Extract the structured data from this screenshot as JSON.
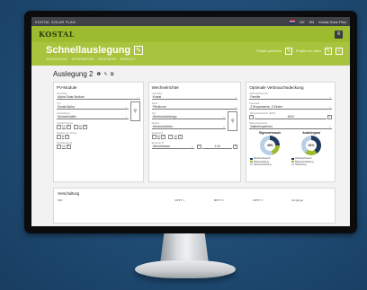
{
  "topbar": {
    "app_title": "KOSTAL SOLAR PLAN",
    "right_items": [
      "DE",
      "EN",
      "Kostal Solar Plan"
    ]
  },
  "brand": {
    "logo": "KOSTAL"
  },
  "page": {
    "title": "Schnellauslegung",
    "breadcrumb": [
      "AUSLEGUNG",
      "ERGEBNISSE",
      "GRAFIKEN",
      "BERICHT"
    ],
    "actions": [
      "Projekt speichern",
      "Projekt neu laden"
    ]
  },
  "variant": {
    "title": "Auslegung 2",
    "icons": "❶ ✎ ⧉"
  },
  "pv_panel": {
    "title": "PV-Module",
    "fields": [
      {
        "label": "Hersteller",
        "value": "Alpha Solar Module"
      },
      {
        "label": "Typ",
        "value": "Kostal Alpha"
      },
      {
        "label": "Ausrichtung",
        "value": "Monokristallin"
      }
    ],
    "num_rows": [
      {
        "label": "Anzahl Strings",
        "values": [
          "10",
          "10"
        ]
      },
      {
        "label": "Module pro String",
        "values": [
          "8"
        ]
      },
      {
        "label": "Modulleistung",
        "values": [
          "10"
        ]
      }
    ]
  },
  "inverter_panel": {
    "title": "Wechselrichter",
    "fields": [
      {
        "label": "Hersteller",
        "value": "Kostal"
      },
      {
        "label": "Serie",
        "value": "Plenticore"
      },
      {
        "label": "Typ",
        "value": "Wechselrichtertyp"
      },
      {
        "label": "Modell",
        "value": "Wechselrichter"
      }
    ],
    "num_rows": [
      {
        "label": "Eingang A",
        "values": [
          "10",
          "10"
        ]
      },
      {
        "label": "Eingang B",
        "values": [
          "Übernehmen",
          "1.00"
        ]
      }
    ]
  },
  "optimal_panel": {
    "title": "Optimale Verbrauchsdeckung",
    "fields": [
      {
        "label": "Verbrauchsprofil",
        "value": "Familie"
      },
      {
        "label": "Haushalt",
        "value": "2 Erwachsene, 2 Kinder"
      },
      {
        "label": "Jahresverbrauch (kWh)",
        "value": "4000"
      },
      {
        "label": "Batteriespeicher",
        "value": "Batteriespeicher"
      }
    ],
    "charts": [
      {
        "title": "Eigenverbrauch",
        "center": "45%",
        "legend": [
          "Direktverbrauch",
          "Batterieladung",
          "Netzeinspeisung"
        ]
      },
      {
        "title": "Autarkiegrad",
        "center": "61%",
        "legend": [
          "Direktverbrauch",
          "Batterieentladung",
          "Netzbezug"
        ]
      }
    ]
  },
  "bottom": {
    "title": "Verschaltung",
    "columns": [
      "MW",
      "MPPT 1",
      "MPPT 2",
      "MPPT 3",
      "Eingänge"
    ]
  },
  "colors": {
    "brand_green": "#9cbb2e",
    "title_green": "#a8c43e",
    "chart_dark": "#1f3a5f",
    "chart_green": "#9cbb2e",
    "chart_light": "#b9cfe6"
  },
  "chart_data": [
    {
      "type": "pie",
      "title": "Eigenverbrauch",
      "categories": [
        "Direktverbrauch",
        "Batterieladung",
        "Netzeinspeisung"
      ],
      "values": [
        25,
        20,
        55
      ]
    },
    {
      "type": "pie",
      "title": "Autarkiegrad",
      "categories": [
        "Direktverbrauch",
        "Batterieentladung",
        "Netzbezug"
      ],
      "values": [
        40,
        21,
        39
      ]
    }
  ]
}
